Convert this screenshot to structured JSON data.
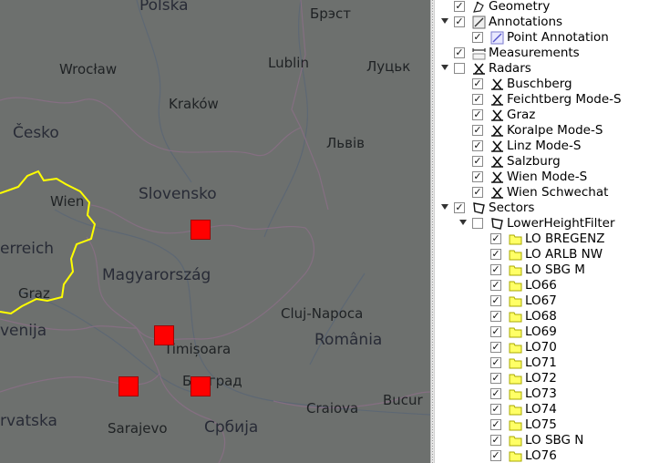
{
  "map": {
    "labels": [
      {
        "text": "Polska",
        "kind": "country"
      },
      {
        "text": "Брэст",
        "kind": "city"
      },
      {
        "text": "Wrocław",
        "kind": "city"
      },
      {
        "text": "Lublin",
        "kind": "city"
      },
      {
        "text": "Луцьк",
        "kind": "city"
      },
      {
        "text": "Kraków",
        "kind": "city"
      },
      {
        "text": "Česko",
        "kind": "country"
      },
      {
        "text": "Львів",
        "kind": "city"
      },
      {
        "text": "Wien",
        "kind": "city"
      },
      {
        "text": "Slovensko",
        "kind": "country"
      },
      {
        "text": "erreich",
        "kind": "country"
      },
      {
        "text": "Magyarország",
        "kind": "country"
      },
      {
        "text": "Graz",
        "kind": "city"
      },
      {
        "text": "Cluj-Napoca",
        "kind": "city"
      },
      {
        "text": "venija",
        "kind": "country"
      },
      {
        "text": "Timișoara",
        "kind": "city"
      },
      {
        "text": "România",
        "kind": "country"
      },
      {
        "text": "Београд",
        "kind": "city"
      },
      {
        "text": "Bucur",
        "kind": "city"
      },
      {
        "text": "rvatska",
        "kind": "country"
      },
      {
        "text": "Sarajevo",
        "kind": "city"
      },
      {
        "text": "Србија",
        "kind": "country"
      },
      {
        "text": "Craiova",
        "kind": "city"
      }
    ],
    "marker_color": "#ff0000",
    "boundary_color": "#ffff00"
  },
  "tree": {
    "rows": [
      {
        "label": "Geometry",
        "checked": true,
        "icon": "geometry-icon",
        "arrow": false
      },
      {
        "label": "Annotations",
        "checked": true,
        "icon": "annotation-icon",
        "arrow": true
      },
      {
        "label": "Point Annotation",
        "checked": true,
        "icon": "point-annotation-icon",
        "arrow": false
      },
      {
        "label": "Measurements",
        "checked": true,
        "icon": "measurement-icon",
        "arrow": false
      },
      {
        "label": "Radars",
        "checked": false,
        "icon": "radar-group-icon",
        "arrow": true
      },
      {
        "label": "Buschberg",
        "checked": true,
        "icon": "radar-icon",
        "arrow": false
      },
      {
        "label": "Feichtberg Mode-S",
        "checked": true,
        "icon": "radar-icon",
        "arrow": false
      },
      {
        "label": "Graz",
        "checked": true,
        "icon": "radar-icon",
        "arrow": false
      },
      {
        "label": "Koralpe Mode-S",
        "checked": true,
        "icon": "radar-icon",
        "arrow": false
      },
      {
        "label": "Linz Mode-S",
        "checked": true,
        "icon": "radar-icon",
        "arrow": false
      },
      {
        "label": "Salzburg",
        "checked": true,
        "icon": "radar-icon",
        "arrow": false
      },
      {
        "label": "Wien Mode-S",
        "checked": true,
        "icon": "radar-icon",
        "arrow": false
      },
      {
        "label": "Wien Schwechat",
        "checked": true,
        "icon": "radar-icon",
        "arrow": false
      },
      {
        "label": "Sectors",
        "checked": true,
        "icon": "sector-group-icon",
        "arrow": true
      },
      {
        "label": "LowerHeightFilter",
        "checked": false,
        "icon": "sector-group-icon",
        "arrow": true
      },
      {
        "label": "LO BREGENZ",
        "checked": true,
        "icon": "folder-icon",
        "arrow": false
      },
      {
        "label": "LO ARLB NW",
        "checked": true,
        "icon": "folder-icon",
        "arrow": false
      },
      {
        "label": "LO SBG M",
        "checked": true,
        "icon": "folder-icon",
        "arrow": false
      },
      {
        "label": "LO66",
        "checked": true,
        "icon": "folder-icon",
        "arrow": false
      },
      {
        "label": "LO67",
        "checked": true,
        "icon": "folder-icon",
        "arrow": false
      },
      {
        "label": "LO68",
        "checked": true,
        "icon": "folder-icon",
        "arrow": false
      },
      {
        "label": "LO69",
        "checked": true,
        "icon": "folder-icon",
        "arrow": false
      },
      {
        "label": "LO70",
        "checked": true,
        "icon": "folder-icon",
        "arrow": false
      },
      {
        "label": "LO71",
        "checked": true,
        "icon": "folder-icon",
        "arrow": false
      },
      {
        "label": "LO72",
        "checked": true,
        "icon": "folder-icon",
        "arrow": false
      },
      {
        "label": "LO73",
        "checked": true,
        "icon": "folder-icon",
        "arrow": false
      },
      {
        "label": "LO74",
        "checked": true,
        "icon": "folder-icon",
        "arrow": false
      },
      {
        "label": "LO75",
        "checked": true,
        "icon": "folder-icon",
        "arrow": false
      },
      {
        "label": "LO SBG N",
        "checked": true,
        "icon": "folder-icon",
        "arrow": false
      },
      {
        "label": "LO76",
        "checked": true,
        "icon": "folder-icon",
        "arrow": false
      }
    ]
  }
}
